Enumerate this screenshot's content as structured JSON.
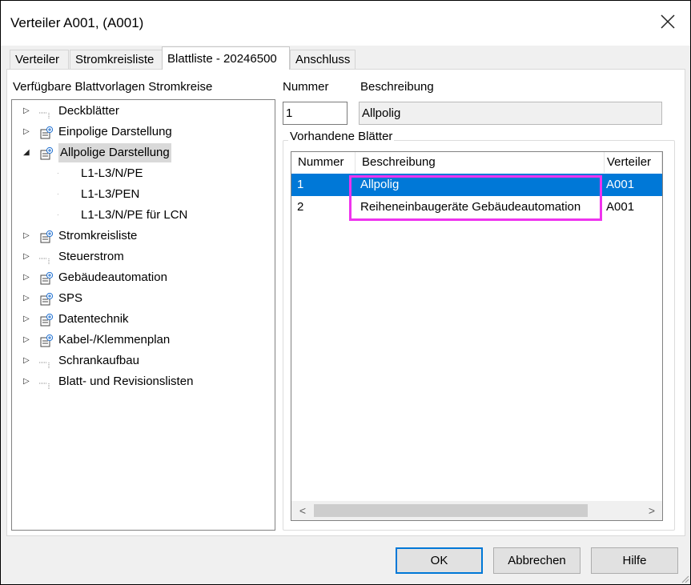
{
  "window": {
    "title": "Verteiler A001,  (A001)"
  },
  "tabs": [
    {
      "label": "Verteiler",
      "active": false
    },
    {
      "label": "Stromkreisliste",
      "active": false
    },
    {
      "label": "Blattliste - 20246500",
      "active": true
    },
    {
      "label": "Anschluss",
      "active": false
    }
  ],
  "tree": {
    "heading": "Verfügbare Blattvorlagen Stromkreise",
    "items": [
      {
        "label": "Deckblätter",
        "icon": "dots-icon",
        "level": 0,
        "expander": "▷"
      },
      {
        "label": "Einpolige Darstellung",
        "icon": "sheet-plus-icon",
        "level": 0,
        "expander": "▷"
      },
      {
        "label": "Allpolige Darstellung",
        "icon": "sheet-plus-icon",
        "level": 0,
        "expander": "◢",
        "selected": true
      },
      {
        "label": "L1-L3/N/PE",
        "level": 1
      },
      {
        "label": "L1-L3/PEN",
        "level": 1
      },
      {
        "label": "L1-L3/N/PE für LCN",
        "level": 1
      },
      {
        "label": "Stromkreisliste",
        "icon": "sheet-plus-icon",
        "level": 0,
        "expander": "▷"
      },
      {
        "label": "Steuerstrom",
        "icon": "dots-icon",
        "level": 0,
        "expander": "▷"
      },
      {
        "label": "Gebäudeautomation",
        "icon": "sheet-plus-icon",
        "level": 0,
        "expander": "▷"
      },
      {
        "label": "SPS",
        "icon": "sheet-plus-icon",
        "level": 0,
        "expander": "▷"
      },
      {
        "label": "Datentechnik",
        "icon": "sheet-plus-icon",
        "level": 0,
        "expander": "▷"
      },
      {
        "label": "Kabel-/Klemmenplan",
        "icon": "sheet-plus-icon",
        "level": 0,
        "expander": "▷"
      },
      {
        "label": "Schrankaufbau",
        "icon": "dots-icon",
        "level": 0,
        "expander": "▷"
      },
      {
        "label": "Blatt- und Revisionslisten",
        "icon": "dots-icon",
        "level": 0,
        "expander": "▷"
      }
    ]
  },
  "form": {
    "nummer_label": "Nummer",
    "beschreibung_label": "Beschreibung",
    "nummer_value": "1",
    "beschreibung_value": "Allpolig"
  },
  "sheets": {
    "group_label": "Vorhandene Blätter",
    "columns": [
      "Nummer",
      "Beschreibung",
      "Verteiler"
    ],
    "rows": [
      {
        "nummer": "1",
        "beschreibung": "Allpolig",
        "verteiler": "A001",
        "selected": true
      },
      {
        "nummer": "2",
        "beschreibung": "Reiheneinbaugeräte Gebäudeautomation",
        "verteiler": "A001",
        "selected": false
      }
    ],
    "scroll_left": "<",
    "scroll_right": ">"
  },
  "buttons": {
    "ok": "OK",
    "cancel": "Abbrechen",
    "help": "Hilfe"
  },
  "colors": {
    "selection": "#0078d7",
    "highlight": "#ee33ee"
  }
}
